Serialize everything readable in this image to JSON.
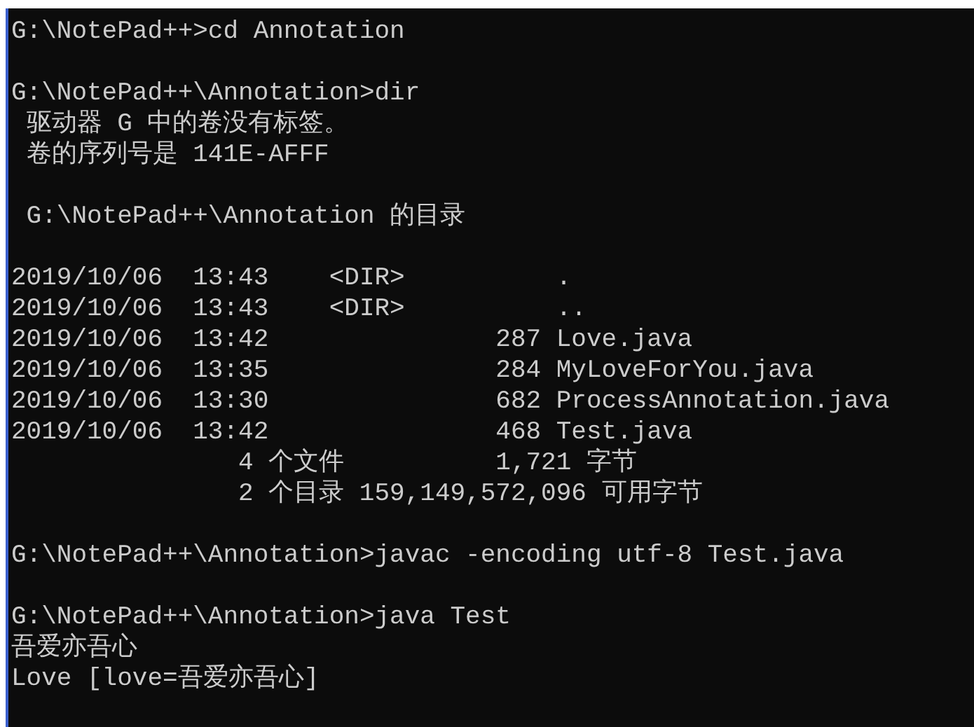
{
  "console": {
    "blocks": [
      [
        "G:\\NotePad++>cd Annotation"
      ],
      [
        "G:\\NotePad++\\Annotation>dir",
        " 驱动器 G 中的卷没有标签。",
        " 卷的序列号是 141E-AFFF"
      ],
      [
        " G:\\NotePad++\\Annotation 的目录"
      ],
      [
        "2019/10/06  13:43    <DIR>          .",
        "2019/10/06  13:43    <DIR>          ..",
        "2019/10/06  13:42               287 Love.java",
        "2019/10/06  13:35               284 MyLoveForYou.java",
        "2019/10/06  13:30               682 ProcessAnnotation.java",
        "2019/10/06  13:42               468 Test.java",
        "               4 个文件          1,721 字节",
        "               2 个目录 159,149,572,096 可用字节"
      ],
      [
        "G:\\NotePad++\\Annotation>javac -encoding utf-8 Test.java"
      ],
      [
        "G:\\NotePad++\\Annotation>java Test",
        "吾爱亦吾心",
        "Love [love=吾爱亦吾心]"
      ]
    ]
  }
}
